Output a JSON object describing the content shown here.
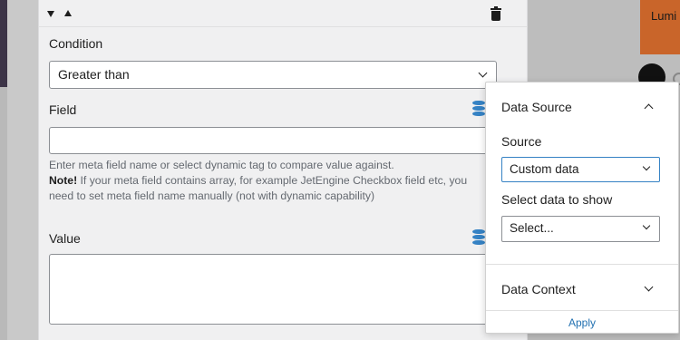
{
  "background": {
    "card_text": "Lumi"
  },
  "condition_panel": {
    "condition_label": "Condition",
    "condition_value": "Greater than",
    "field_label": "Field",
    "field_value": "",
    "help_text": "Enter meta field name or select dynamic tag to compare value against.",
    "note_label": "Note!",
    "note_text": " If your meta field contains array, for example JetEngine Checkbox field etc, you need to set meta field name manually (not with dynamic capability)",
    "value_label": "Value",
    "value_value": ""
  },
  "popover": {
    "data_source_title": "Data Source",
    "source_label": "Source",
    "source_value": "Custom data",
    "select_data_label": "Select data to show",
    "select_data_value": "Select...",
    "data_context_title": "Data Context",
    "apply_label": "Apply"
  },
  "icons": [
    "move-down-icon",
    "move-up-icon",
    "trash-icon",
    "dynamic-data-icon",
    "chevron-down-icon",
    "chevron-up-icon"
  ],
  "colors": {
    "accent": "#3582c4",
    "link": "#2271b1",
    "brand_orange": "#c9652a"
  }
}
